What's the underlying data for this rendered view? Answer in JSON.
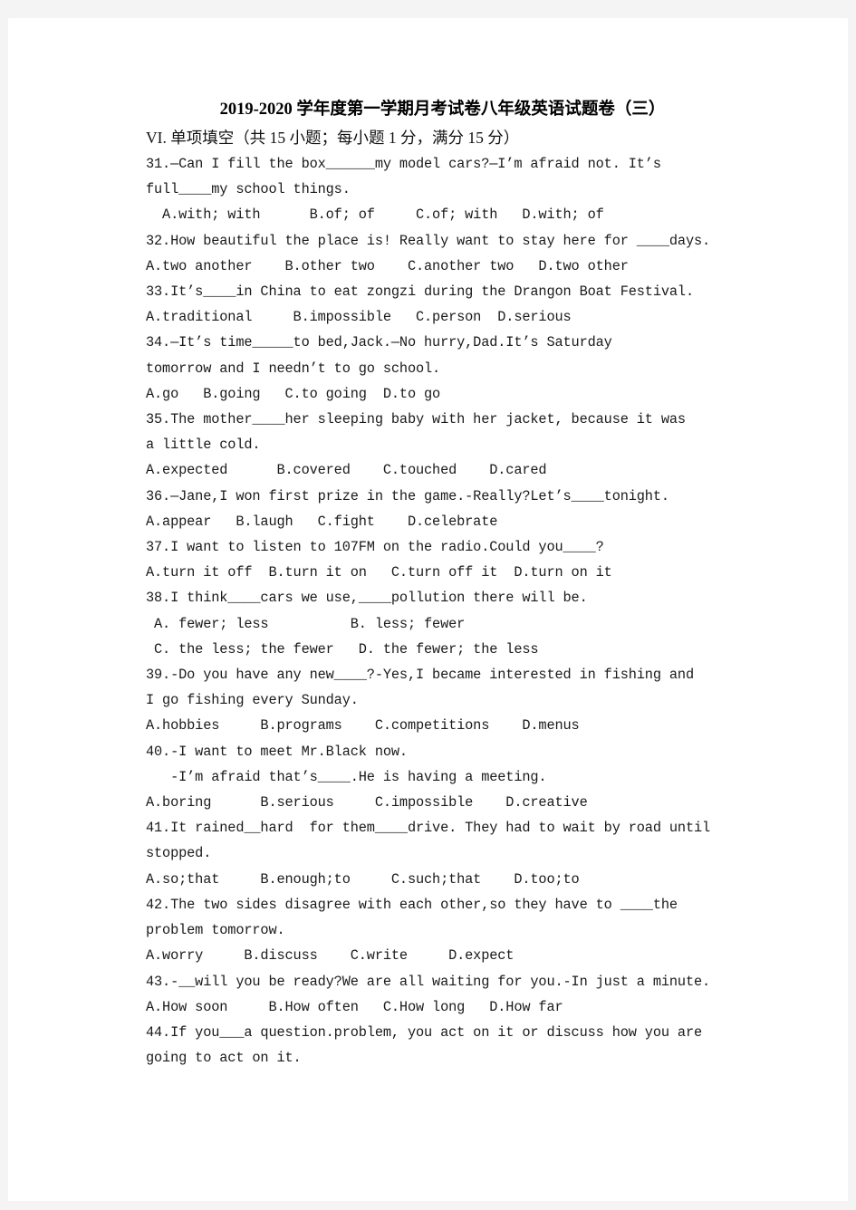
{
  "document": {
    "title": "2019-2020 学年度第一学期月考试卷八年级英语试题卷（三）",
    "section_heading": "VI. 单项填空（共 15 小题；每小题 1 分，满分 15 分）",
    "questions": [
      {
        "number": "31",
        "stem_lines": [
          "31.—Can I fill the box______my model cars?—I’m afraid not. It’s",
          "full____my school things."
        ],
        "option_lines": [
          "  A.with; with      B.of; of     C.of; with   D.with; of"
        ],
        "indents": [
          0,
          0
        ],
        "option_indents": [
          0
        ]
      },
      {
        "number": "32",
        "stem_lines": [
          "32.How beautiful the place is! Really want to stay here for ____days."
        ],
        "option_lines": [
          "A.two another    B.other two    C.another two   D.two other"
        ],
        "indents": [
          0
        ],
        "option_indents": [
          0
        ]
      },
      {
        "number": "33",
        "stem_lines": [
          "33.It’s____in China to eat zongzi during the Drangon Boat Festival."
        ],
        "option_lines": [
          "A.traditional     B.impossible   C.person  D.serious"
        ],
        "indents": [
          0
        ],
        "option_indents": [
          0
        ]
      },
      {
        "number": "34",
        "stem_lines": [
          "34.—It’s time_____to bed,Jack.—No hurry,Dad.It’s Saturday",
          "tomorrow and I needn’t to go school."
        ],
        "option_lines": [
          "A.go   B.going   C.to going  D.to go"
        ],
        "indents": [
          0,
          0
        ],
        "option_indents": [
          0
        ]
      },
      {
        "number": "35",
        "stem_lines": [
          "35.The mother____her sleeping baby with her jacket, because it was",
          "a little cold."
        ],
        "option_lines": [
          "A.expected      B.covered    C.touched    D.cared"
        ],
        "indents": [
          0,
          0
        ],
        "option_indents": [
          0
        ]
      },
      {
        "number": "36",
        "stem_lines": [
          "36.—Jane,I won first prize in the game.-Really?Let’s____tonight."
        ],
        "option_lines": [
          "A.appear   B.laugh   C.fight    D.celebrate"
        ],
        "indents": [
          0
        ],
        "option_indents": [
          0
        ]
      },
      {
        "number": "37",
        "stem_lines": [
          "37.I want to listen to 107FM on the radio.Could you____?"
        ],
        "option_lines": [
          "A.turn it off  B.turn it on   C.turn off it  D.turn on it"
        ],
        "indents": [
          0
        ],
        "option_indents": [
          0
        ]
      },
      {
        "number": "38",
        "stem_lines": [
          "38.I think____cars we use,____pollution there will be."
        ],
        "option_lines": [
          " A. fewer; less          B. less; fewer",
          " C. the less; the fewer   D. the fewer; the less"
        ],
        "indents": [
          0
        ],
        "option_indents": [
          0,
          0
        ]
      },
      {
        "number": "39",
        "stem_lines": [
          "39.-Do you have any new____?-Yes,I became interested in fishing and",
          "I go fishing every Sunday."
        ],
        "option_lines": [
          "A.hobbies     B.programs    C.competitions    D.menus"
        ],
        "indents": [
          0,
          0
        ],
        "option_indents": [
          0
        ]
      },
      {
        "number": "40",
        "stem_lines": [
          "40.-I want to meet Mr.Black now.",
          "   -I’m afraid that’s____.He is having a meeting."
        ],
        "option_lines": [
          "A.boring      B.serious     C.impossible    D.creative"
        ],
        "indents": [
          0,
          0
        ],
        "option_indents": [
          0
        ]
      },
      {
        "number": "41",
        "stem_lines": [
          "41.It rained__hard  for them____drive. They had to wait by road until",
          "stopped."
        ],
        "option_lines": [
          "A.so;that     B.enough;to     C.such;that    D.too;to"
        ],
        "indents": [
          0,
          0
        ],
        "option_indents": [
          0
        ]
      },
      {
        "number": "42",
        "stem_lines": [
          "42.The two sides disagree with each other,so they have to ____the",
          "problem tomorrow."
        ],
        "option_lines": [
          "A.worry     B.discuss    C.write     D.expect"
        ],
        "indents": [
          0,
          0
        ],
        "option_indents": [
          0
        ]
      },
      {
        "number": "43",
        "stem_lines": [
          "43.-__will you be ready?We are all waiting for you.-In just a minute."
        ],
        "option_lines": [
          "A.How soon     B.How often   C.How long   D.How far"
        ],
        "indents": [
          0
        ],
        "option_indents": [
          0
        ]
      },
      {
        "number": "44",
        "stem_lines": [
          "44.If you___a question.problem, you act on it or discuss how you are",
          "going to act on it."
        ],
        "option_lines": [],
        "indents": [
          0,
          0
        ],
        "option_indents": []
      }
    ]
  },
  "colors": {
    "page_background": "#ffffff",
    "canvas_background": "#f4f4f4",
    "text": "#1a1a1a"
  }
}
